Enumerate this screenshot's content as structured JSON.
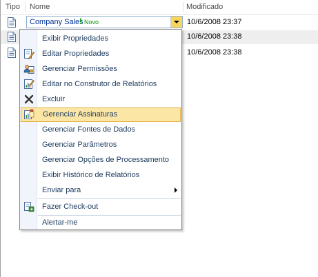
{
  "header": {
    "col_tipo": "Tipo",
    "col_nome": "Nome",
    "col_modificado": "Modificado"
  },
  "rows": [
    {
      "name": "Company Sales",
      "new_mark": "!",
      "new_label": "Novo",
      "modified": "10/6/2008 23:37",
      "icon": "document-icon"
    },
    {
      "modified": "10/6/2008 23:38",
      "icon": "document-icon"
    },
    {
      "modified": "10/6/2008 23:38",
      "icon": "document-icon"
    }
  ],
  "menu": {
    "items": [
      {
        "label": "Exibir Propriedades",
        "icon": ""
      },
      {
        "label": "Editar Propriedades",
        "icon": "edit-properties-icon"
      },
      {
        "label": "Gerenciar Permissões",
        "icon": "permissions-icon"
      },
      {
        "label": "Editar no Construtor de Relatórios",
        "icon": "report-builder-icon"
      },
      {
        "label": "Excluir",
        "icon": "delete-icon"
      },
      {
        "label": "Gerenciar Assinaturas",
        "icon": "subscriptions-icon",
        "highlighted": true
      },
      {
        "label": "Gerenciar Fontes de Dados",
        "icon": ""
      },
      {
        "label": "Gerenciar Parâmetros",
        "icon": ""
      },
      {
        "label": "Gerenciar Opções de Processamento",
        "icon": ""
      },
      {
        "label": "Exibir Histórico de Relatórios",
        "icon": ""
      },
      {
        "label": "Enviar para",
        "icon": "",
        "submenu": true
      },
      {
        "label": "Fazer Check-out",
        "icon": "check-out-icon"
      },
      {
        "label": "Alertar-me",
        "icon": ""
      }
    ]
  },
  "colors": {
    "highlight_bg": "#fce6a6",
    "highlight_border": "#e3b13f",
    "link_blue": "#003399",
    "new_green": "#009900",
    "dropdown_button": "#f7d55e"
  }
}
